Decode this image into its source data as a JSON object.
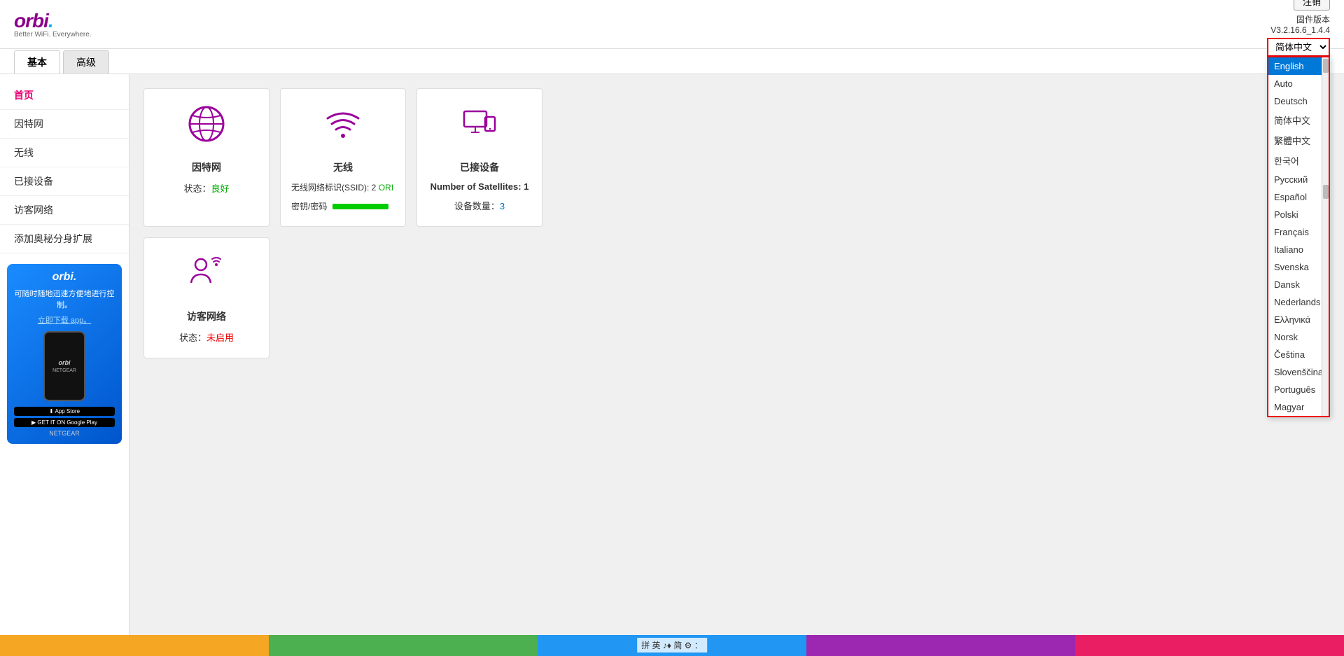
{
  "header": {
    "logo_text": "orbi",
    "logo_tagline": "Better WiFi. Everywhere.",
    "logout_label": "注销",
    "firmware_label": "固件版本",
    "firmware_version": "V3.2.16.6_1.4.4",
    "lang_current": "简体中文"
  },
  "nav": {
    "tabs": [
      {
        "label": "基本",
        "active": true
      },
      {
        "label": "高级",
        "active": false
      }
    ]
  },
  "sidebar": {
    "items": [
      {
        "label": "首页",
        "active": true
      },
      {
        "label": "因特网",
        "active": false
      },
      {
        "label": "无线",
        "active": false
      },
      {
        "label": "已接设备",
        "active": false
      },
      {
        "label": "访客网络",
        "active": false
      },
      {
        "label": "添加奥秘分身扩展",
        "active": false
      }
    ]
  },
  "sidebar_ad": {
    "logo": "orbi.",
    "text": "可随时随地迅速方便地进行控制。",
    "link_label": "立即下载 app。",
    "netgear": "NETGEAR"
  },
  "cards": [
    {
      "id": "internet",
      "title": "因特网",
      "icon": "globe",
      "status_label": "状态：",
      "status_value": "良好",
      "status_color": "good"
    },
    {
      "id": "wireless",
      "title": "无线",
      "icon": "wifi",
      "ssid_label": "无线网络标识(SSID): 2",
      "ssid_value": "ORI",
      "password_label": "密钥/密码"
    },
    {
      "id": "connected-devices",
      "title": "已接设备",
      "icon": "devices",
      "satellites_label": "Number of Satellites: 1",
      "devices_label": "设备数量：",
      "devices_value": "3",
      "devices_color": "blue"
    },
    {
      "id": "guest-network",
      "title": "访客网络",
      "icon": "guests",
      "status_label": "状态：",
      "status_value": "未启用",
      "status_color": "inactive"
    }
  ],
  "language_dropdown": {
    "options": [
      {
        "label": "English",
        "selected": true
      },
      {
        "label": "Auto",
        "selected": false
      },
      {
        "label": "Deutsch",
        "selected": false
      },
      {
        "label": "简体中文",
        "selected": false
      },
      {
        "label": "繁體中文",
        "selected": false
      },
      {
        "label": "한국어",
        "selected": false
      },
      {
        "label": "Русский",
        "selected": false
      },
      {
        "label": "Español",
        "selected": false
      },
      {
        "label": "Polski",
        "selected": false
      },
      {
        "label": "Français",
        "selected": false
      },
      {
        "label": "Italiano",
        "selected": false
      },
      {
        "label": "Svenska",
        "selected": false
      },
      {
        "label": "Dansk",
        "selected": false
      },
      {
        "label": "Nederlands",
        "selected": false
      },
      {
        "label": "Ελληνικά",
        "selected": false
      },
      {
        "label": "Norsk",
        "selected": false
      },
      {
        "label": "Čeština",
        "selected": false
      },
      {
        "label": "Slovenščina",
        "selected": false
      },
      {
        "label": "Português",
        "selected": false
      },
      {
        "label": "Magyar",
        "selected": false
      }
    ]
  },
  "bottom_bar": {
    "status_text": "拼 英 ♪♦ 简 ⚙ ："
  }
}
